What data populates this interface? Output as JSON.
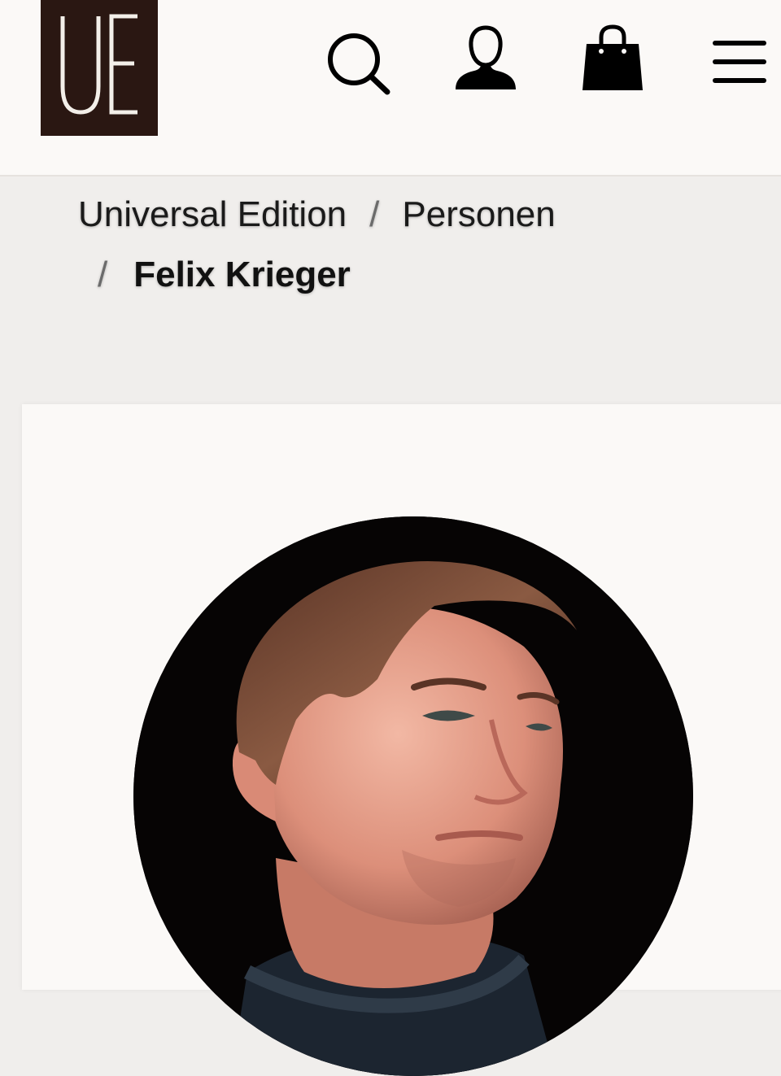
{
  "header": {
    "logo_text": "UE",
    "icons": {
      "search": "search-icon",
      "account": "user-icon",
      "cart": "shopping-bag-icon",
      "menu": "hamburger-menu-icon"
    },
    "logo_color": "#2a1712"
  },
  "breadcrumb": {
    "items": [
      {
        "label": "Universal Edition"
      },
      {
        "label": "Personen"
      }
    ],
    "separator": "/",
    "current": "Felix Krieger"
  },
  "profile": {
    "photo_icon": "person-portrait"
  },
  "colors": {
    "header_bg": "#fbf9f7",
    "page_bg": "#f0eeec",
    "text": "#1a1a1a"
  }
}
